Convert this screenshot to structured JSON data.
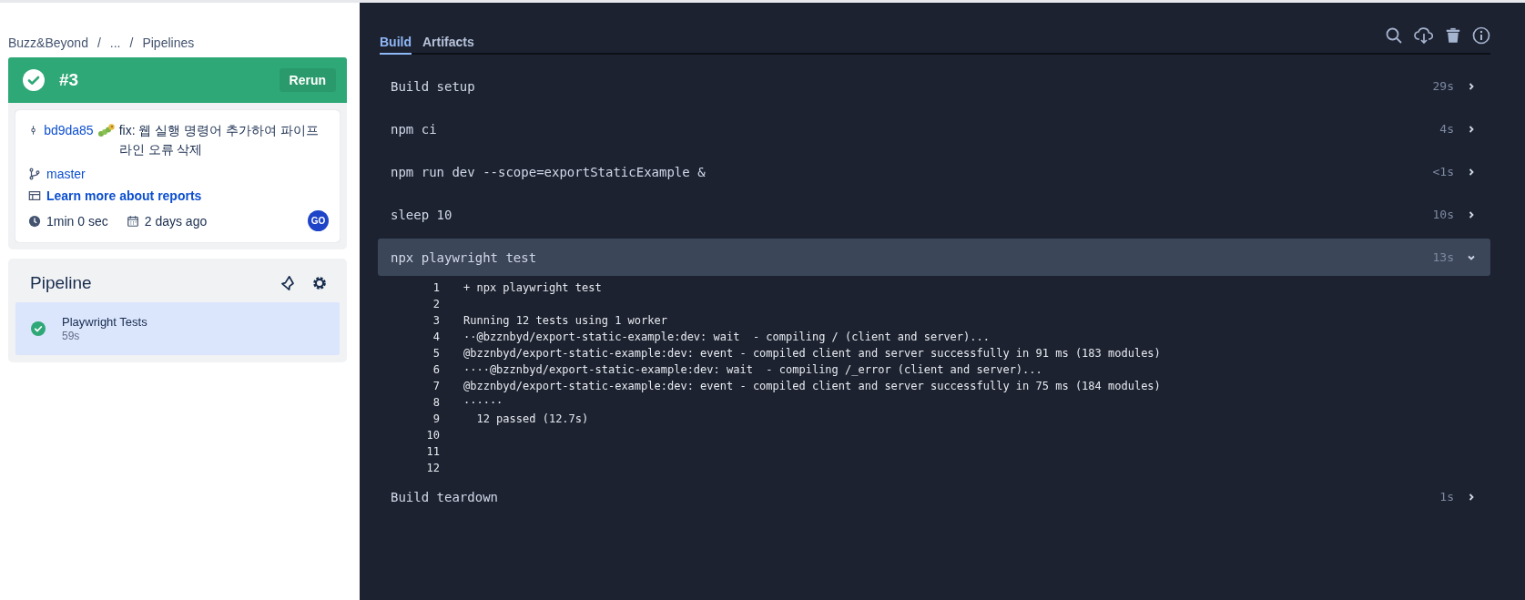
{
  "breadcrumbs": [
    {
      "label": "Buzz&Beyond"
    },
    {
      "separator": "/",
      "label": "..."
    },
    {
      "separator": "/",
      "label": "Pipelines"
    }
  ],
  "run": {
    "success": true,
    "number": "#3",
    "rerun": "Rerun"
  },
  "commit": {
    "hash": "bd9da85",
    "message": "fix: 웹 실행 명령어 추가하여 파이프라인 오류 삭제",
    "branch": "master",
    "reports_link": "Learn more about reports",
    "duration": "1min 0 sec",
    "date": "2 days ago",
    "avatar": "GO"
  },
  "pipeline": {
    "title": "Pipeline",
    "steps": [
      {
        "name": "Playwright Tests",
        "duration": "59s",
        "success": true,
        "selected": true
      }
    ]
  },
  "tabs": [
    {
      "label": "Build",
      "selected": true
    },
    {
      "label": "Artifacts",
      "selected": false
    }
  ],
  "steps": [
    {
      "name": "Build setup",
      "duration": "29s",
      "expanded": false
    },
    {
      "name": "npm ci",
      "duration": "4s",
      "expanded": false
    },
    {
      "name": "npm run dev --scope=exportStaticExample &",
      "duration": "<1s",
      "expanded": false
    },
    {
      "name": "sleep 10",
      "duration": "10s",
      "expanded": false
    },
    {
      "name": "npx playwright test",
      "duration": "13s",
      "expanded": true,
      "log": [
        {
          "number": "1",
          "text": "+ npx playwright test"
        },
        {
          "number": "2"
        },
        {
          "number": "3",
          "text": "Running 12 tests using 1 worker"
        },
        {
          "number": "4",
          "text": "··@bzznbyd/export-static-example:dev: wait  - compiling / (client and server)..."
        },
        {
          "number": "5",
          "text": "@bzznbyd/export-static-example:dev: event - compiled client and server successfully in 91 ms (183 modules)"
        },
        {
          "number": "6",
          "text": "····@bzznbyd/export-static-example:dev: wait  - compiling /_error (client and server)..."
        },
        {
          "number": "7",
          "text": "@bzznbyd/export-static-example:dev: event - compiled client and server successfully in 75 ms (184 modules)"
        },
        {
          "number": "8",
          "text": "······"
        },
        {
          "number": "9",
          "text": "  12 passed (12.7s)"
        },
        {
          "number": "10"
        },
        {
          "number": "11"
        },
        {
          "number": "12"
        }
      ]
    },
    {
      "name": "Build teardown",
      "duration": "1s",
      "expanded": false
    }
  ]
}
